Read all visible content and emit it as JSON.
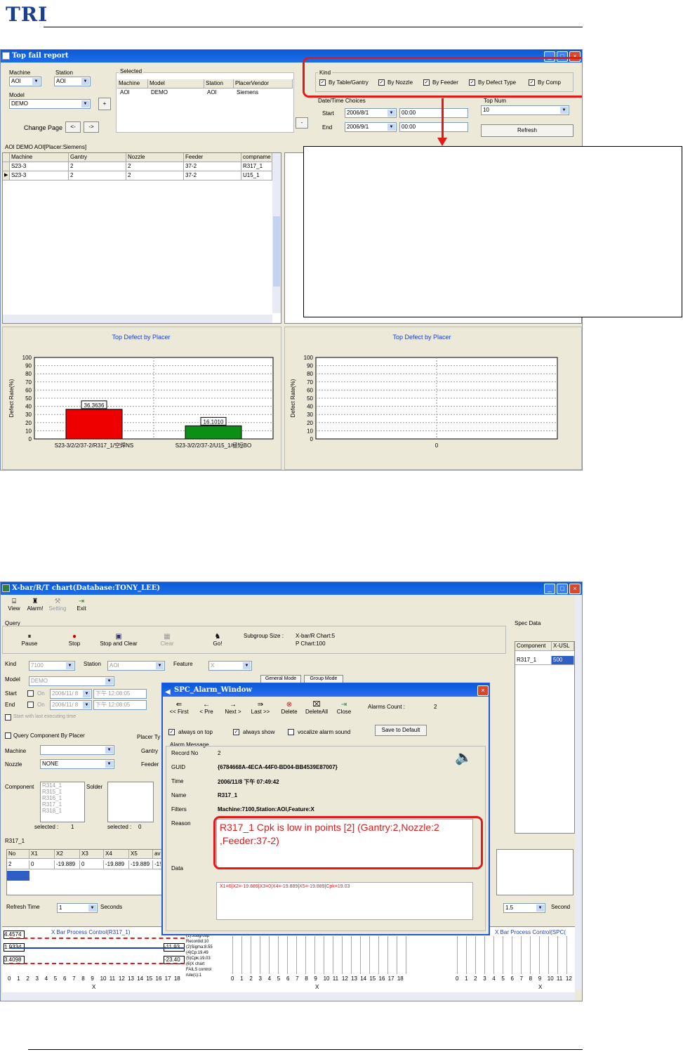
{
  "logo_text": "TRI",
  "top_window": {
    "title": "Top fail report",
    "machine_label": "Machine",
    "machine_value": "AOI",
    "station_label": "Station",
    "station_value": "AOI",
    "model_label": "Model",
    "model_value": "DEMO",
    "plus_label": "+",
    "change_page_label": "Change Page",
    "prev_label": "<-",
    "next_label": "->",
    "selected_label": "Selected",
    "selected_headers": [
      "Machine",
      "Model",
      "Station",
      "PlacerVendor"
    ],
    "selected_row": [
      "AOI",
      "DEMO",
      "AOI",
      "Siemens"
    ],
    "minus_label": "-",
    "kind_label": "Kind",
    "kind_options": [
      "By Table/Gantry",
      "By Nozzle",
      "By Feeder",
      "By Defect Type",
      "By Comp"
    ],
    "datetime_label": "Date/Time Choices",
    "start_label": "Start",
    "start_date": "2006/8/1",
    "start_time": "00:00",
    "end_label": "End",
    "end_date": "2006/9/1",
    "end_time": "00:00",
    "topnum_label": "Top Num",
    "topnum_value": "10",
    "refresh_label": "Refresh",
    "grid_caption": "AOI DEMO AOI[Placer:Siemens]",
    "grid_headers": [
      "Machine",
      "Gantry",
      "Nozzle",
      "Feeder",
      "compname"
    ],
    "grid_rows": [
      [
        "S23-3",
        "2",
        "2",
        "37-2",
        "R317_1"
      ],
      [
        "S23-3",
        "2",
        "2",
        "37-2",
        "U15_1"
      ]
    ]
  },
  "left_chart_title": "Top Defect by Placer",
  "right_chart_title": "Top Defect by Placer",
  "chart_data": [
    {
      "type": "bar",
      "title": "Top Defect by Placer",
      "ylabel": "Defect Rate(%)",
      "ylim": [
        0,
        100
      ],
      "yticks": [
        0,
        10,
        20,
        30,
        40,
        50,
        60,
        70,
        80,
        90,
        100
      ],
      "categories": [
        "S23-3/2/2/37-2/R317_1/空焊NS",
        "S23-3/2/2/37-2/U15_1/極短BO"
      ],
      "values": [
        36.3636,
        16.101
      ],
      "value_labels": [
        "36.3636",
        "16.1010"
      ],
      "colors": [
        "#ee0000",
        "#0b8f14"
      ]
    },
    {
      "type": "bar",
      "title": "Top Defect by Placer",
      "ylabel": "Defect Rate(%)",
      "ylim": [
        0,
        100
      ],
      "yticks": [
        0,
        10,
        20,
        30,
        40,
        50,
        60,
        70,
        80,
        90,
        100
      ],
      "categories": [
        "0"
      ],
      "values": []
    }
  ],
  "bottom_window": {
    "title": "X-bar/R/T chart(Database:TONY_LEE)",
    "toolbar": [
      "View",
      "Alarm!",
      "Setting",
      "Exit"
    ],
    "query_label": "Query",
    "query_buttons": [
      "Pause",
      "Stop",
      "Stop and Clear",
      "Clear",
      "Go!"
    ],
    "subgroup_label": "Subgroup Size :",
    "subgroup_xbar": "X-bar/R Chart:5",
    "subgroup_p": "P Chart:100",
    "spec_label": "Spec Data",
    "spec_headers": [
      "Component",
      "X-USL"
    ],
    "spec_row": [
      "R317_1",
      "500"
    ],
    "kind_label": "Kind",
    "kind_value": "7100",
    "station_label": "Station",
    "station_value": "AOI",
    "feature_label": "Feature",
    "feature_value": "X",
    "model_label": "Model",
    "model_value": "DEMO",
    "general_mode": "General Mode",
    "group_mode": "Group Mode",
    "start_label": "Start",
    "end_label": "End",
    "on_label": "On",
    "date_value": "2006/11/ 8",
    "start_time": "下午 12:08:05",
    "end_time": "下午 12:08:05",
    "short_label": "Start with last executing time",
    "query_by_placer": "Query Component By Placer",
    "placer_type": "Placer Ty",
    "machine_label": "Machine",
    "gantry_label": "Gantry",
    "nozzle_label": "Nozzle",
    "nozzle_value": "NONE",
    "feeder_label": "Feeder",
    "component_label": "Component",
    "component_list": [
      "R314_1",
      "R315_1",
      "R316_1",
      "R317_1",
      "R318_1"
    ],
    "solder_label": "Solder",
    "selected1": "selected :",
    "selected1_val": "1",
    "selected2": "selected :",
    "selected2_val": "0",
    "r317_label": "R317_1",
    "data_headers": [
      "No",
      "X1",
      "X2",
      "X3",
      "X4",
      "X5",
      "av"
    ],
    "data_row": [
      "2",
      "0",
      "-19.889",
      "0",
      "-19.889",
      "-19.889",
      "-1!"
    ],
    "refresh_time_label": "Refresh Time",
    "refresh_time_value": "1",
    "seconds_label": "Seconds",
    "right_value": "1.5",
    "right_seconds": "Second",
    "xbar_title": "X Bar Process Control(R317_1)",
    "xbar_title_right": "X Bar Process Control(SPC(",
    "xbar_values": [
      "4.4574",
      "1.9334",
      "3.4098"
    ],
    "xbar_right_values": [
      "-11.93",
      "-23.40"
    ],
    "stats_text": [
      "(1)Subgroup",
      "Recordid:10",
      "(2)Sigma:8.55",
      "(4)Cp:19.49",
      "(5)Cpk:19.03",
      "(6)X chart",
      "FAILS control",
      "rule(s):1"
    ],
    "x_ticks": [
      "0",
      "1",
      "2",
      "3",
      "4",
      "5",
      "6",
      "7",
      "8",
      "9",
      "10",
      "11",
      "12",
      "13",
      "14",
      "15",
      "16",
      "17",
      "18"
    ],
    "x_ticks_right": [
      "0",
      "1",
      "2",
      "3",
      "4",
      "5",
      "6",
      "7",
      "8",
      "9",
      "10",
      "11",
      "12"
    ],
    "x_axis": "X"
  },
  "alarm_window": {
    "title": "SPC_Alarm_Window",
    "nav_buttons": [
      "<< First",
      "< Pre",
      "Next >",
      "Last >>",
      "Delete",
      "DeleteAll",
      "Close"
    ],
    "alarms_count_label": "Alarms Count :",
    "alarms_count": "2",
    "always_on_top": "always on top",
    "always_show": "always show",
    "vocalize": "vocalize alarm sound",
    "save_default": "Save to Default",
    "alarm_message": "Alarm Message",
    "record_no_label": "Record No",
    "record_no": "2",
    "guid_label": "GUID",
    "guid": "{6784668A-4ECA-44F0-BD04-BB4539E87007}",
    "time_label": "Time",
    "time": "2006/11/8 下午 07:49:42",
    "name_label": "Name",
    "name": "R317_1",
    "filters_label": "Filters",
    "filters": "Machine:7100,Station:AOI,Feature:X",
    "reason_label": "Reason",
    "reason": "R317_1 Cpk is low in points [2] (Gantry:2,Nozzle:2 ,Feeder:37-2)",
    "data_label": "Data",
    "data": "X1=0|X2=-19.889|X3=0|X4=-19.889|X5=-19.889|Cpk=19.03"
  }
}
